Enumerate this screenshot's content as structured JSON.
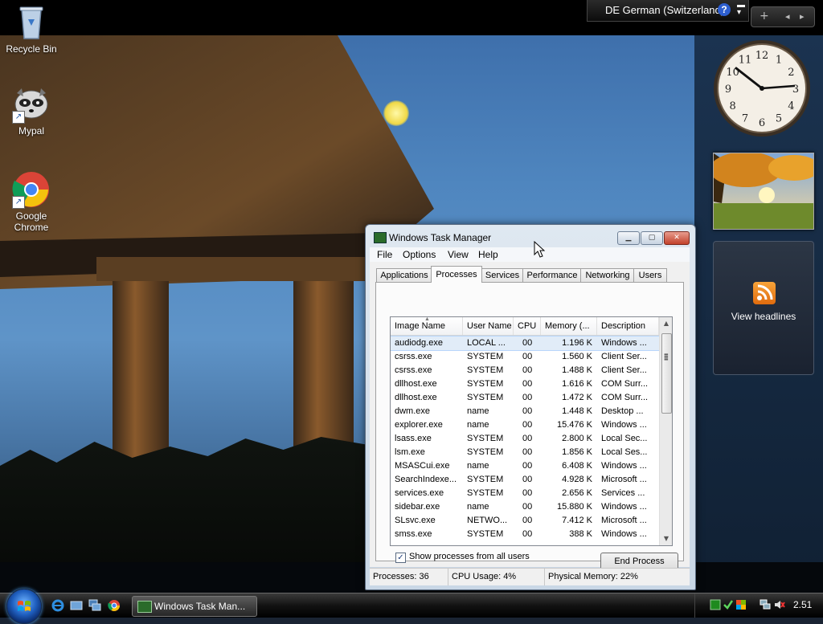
{
  "desktop": {
    "icons": [
      {
        "label": "Recycle Bin",
        "icon": "recycle-bin-icon"
      },
      {
        "label": "Mypal",
        "icon": "mypal-icon"
      },
      {
        "label": "Google Chrome",
        "icon": "chrome-icon"
      }
    ]
  },
  "langbar": {
    "language": "DE German (Switzerland)",
    "help": "?"
  },
  "sidebar_controls": {
    "add": "+",
    "prev": "◂",
    "next": "▸"
  },
  "gadgets": {
    "feed_label": "View headlines",
    "clock_numbers": [
      "12",
      "1",
      "2",
      "3",
      "4",
      "5",
      "6",
      "7",
      "8",
      "9",
      "10",
      "11"
    ]
  },
  "window": {
    "title": "Windows Task Manager",
    "menu": [
      "File",
      "Options",
      "View",
      "Help"
    ],
    "tabs": [
      "Applications",
      "Processes",
      "Services",
      "Performance",
      "Networking",
      "Users"
    ],
    "active_tab": "Processes",
    "columns": [
      "Image Name",
      "User Name",
      "CPU",
      "Memory (...",
      "Description"
    ],
    "rows": [
      [
        "audiodg.exe",
        "LOCAL ...",
        "00",
        "1.196 K",
        "Windows ..."
      ],
      [
        "csrss.exe",
        "SYSTEM",
        "00",
        "1.560 K",
        "Client Ser..."
      ],
      [
        "csrss.exe",
        "SYSTEM",
        "00",
        "1.488 K",
        "Client Ser..."
      ],
      [
        "dllhost.exe",
        "SYSTEM",
        "00",
        "1.616 K",
        "COM Surr..."
      ],
      [
        "dllhost.exe",
        "SYSTEM",
        "00",
        "1.472 K",
        "COM Surr..."
      ],
      [
        "dwm.exe",
        "name",
        "00",
        "1.448 K",
        "Desktop ..."
      ],
      [
        "explorer.exe",
        "name",
        "00",
        "15.476 K",
        "Windows ..."
      ],
      [
        "lsass.exe",
        "SYSTEM",
        "00",
        "2.800 K",
        "Local Sec..."
      ],
      [
        "lsm.exe",
        "SYSTEM",
        "00",
        "1.856 K",
        "Local Ses..."
      ],
      [
        "MSASCui.exe",
        "name",
        "00",
        "6.408 K",
        "Windows ..."
      ],
      [
        "SearchIndexe...",
        "SYSTEM",
        "00",
        "4.928 K",
        "Microsoft ..."
      ],
      [
        "services.exe",
        "SYSTEM",
        "00",
        "2.656 K",
        "Services ..."
      ],
      [
        "sidebar.exe",
        "name",
        "00",
        "15.880 K",
        "Windows ..."
      ],
      [
        "SLsvc.exe",
        "NETWO...",
        "00",
        "7.412 K",
        "Microsoft ..."
      ],
      [
        "smss.exe",
        "SYSTEM",
        "00",
        "388 K",
        "Windows ..."
      ]
    ],
    "show_all_label": "Show processes from all users",
    "show_all_checked": "✓",
    "end_process_label": "End Process",
    "status": {
      "processes": "Processes: 36",
      "cpu": "CPU Usage: 4%",
      "memory": "Physical Memory: 22%"
    }
  },
  "taskbar": {
    "task_label": "Windows Task Man...",
    "time": "2.51"
  }
}
